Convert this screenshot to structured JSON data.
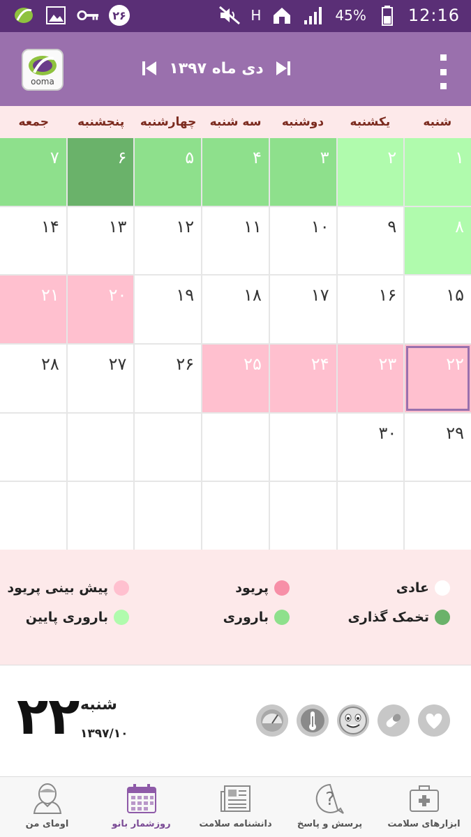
{
  "status_bar": {
    "notification_badge": "۲۶",
    "battery": "45%",
    "time": "12:16",
    "network": "H"
  },
  "header": {
    "logo_text": "ooma",
    "month_title": "دی ماه ۱۳۹۷",
    "colors": {
      "bar": "#9a70ad",
      "status": "#5a2f76"
    }
  },
  "calendar": {
    "weekdays": [
      "شنبه",
      "یکشنبه",
      "دوشنبه",
      "سه شنبه",
      "چهارشنبه",
      "پنجشنبه",
      "جمعه"
    ],
    "days": [
      {
        "label": "۱",
        "type": "low"
      },
      {
        "label": "۲",
        "type": "low"
      },
      {
        "label": "۳",
        "type": "fert"
      },
      {
        "label": "۴",
        "type": "fert"
      },
      {
        "label": "۵",
        "type": "fert"
      },
      {
        "label": "۶",
        "type": "ovul"
      },
      {
        "label": "۷",
        "type": "fert"
      },
      {
        "label": "۸",
        "type": "low"
      },
      {
        "label": "۹",
        "type": "normal"
      },
      {
        "label": "۱۰",
        "type": "normal"
      },
      {
        "label": "۱۱",
        "type": "normal"
      },
      {
        "label": "۱۲",
        "type": "normal"
      },
      {
        "label": "۱۳",
        "type": "normal"
      },
      {
        "label": "۱۴",
        "type": "normal"
      },
      {
        "label": "۱۵",
        "type": "normal"
      },
      {
        "label": "۱۶",
        "type": "normal"
      },
      {
        "label": "۱۷",
        "type": "normal"
      },
      {
        "label": "۱۸",
        "type": "normal"
      },
      {
        "label": "۱۹",
        "type": "normal"
      },
      {
        "label": "۲۰",
        "type": "pred"
      },
      {
        "label": "۲۱",
        "type": "pred"
      },
      {
        "label": "۲۲",
        "type": "pred",
        "today": true
      },
      {
        "label": "۲۳",
        "type": "pred"
      },
      {
        "label": "۲۴",
        "type": "pred"
      },
      {
        "label": "۲۵",
        "type": "pred"
      },
      {
        "label": "۲۶",
        "type": "normal"
      },
      {
        "label": "۲۷",
        "type": "normal"
      },
      {
        "label": "۲۸",
        "type": "normal"
      },
      {
        "label": "۲۹",
        "type": "normal"
      },
      {
        "label": "۳۰",
        "type": "normal"
      },
      {
        "label": "",
        "type": "empty"
      },
      {
        "label": "",
        "type": "empty"
      },
      {
        "label": "",
        "type": "empty"
      },
      {
        "label": "",
        "type": "empty"
      },
      {
        "label": "",
        "type": "empty"
      },
      {
        "label": "",
        "type": "empty"
      },
      {
        "label": "",
        "type": "empty"
      },
      {
        "label": "",
        "type": "empty"
      },
      {
        "label": "",
        "type": "empty"
      },
      {
        "label": "",
        "type": "empty"
      },
      {
        "label": "",
        "type": "empty"
      },
      {
        "label": "",
        "type": "empty"
      }
    ]
  },
  "legend": {
    "normal": {
      "label": "عادی",
      "color": "#ffffff"
    },
    "period": {
      "label": "پریود",
      "color": "#f78fa7"
    },
    "predicted_period": {
      "label": "پیش بینی پریود",
      "color": "#ffc0cf"
    },
    "ovulation": {
      "label": "تخمک گذاری",
      "color": "#6ab26a"
    },
    "fertility": {
      "label": "باروری",
      "color": "#8ee08c"
    },
    "low_fertility": {
      "label": "باروری پایین",
      "color": "#b0fbad"
    }
  },
  "selected_day": {
    "day_number": "۲۲",
    "day_name": "شنبه",
    "date": "۱۳۹۷/۱۰"
  },
  "tools": [
    "heart-icon",
    "pill-icon",
    "smiley-icon",
    "thermometer-icon",
    "scale-icon"
  ],
  "bottom_nav": [
    {
      "label": "ابزارهای سلامت",
      "icon": "medkit-icon"
    },
    {
      "label": "پرسش و پاسخ",
      "icon": "question-icon"
    },
    {
      "label": "دانشنامه سلامت",
      "icon": "newspaper-icon"
    },
    {
      "label": "روزشمار بانو",
      "icon": "calendar-icon",
      "active": true
    },
    {
      "label": "اومای من",
      "icon": "user-icon"
    }
  ]
}
